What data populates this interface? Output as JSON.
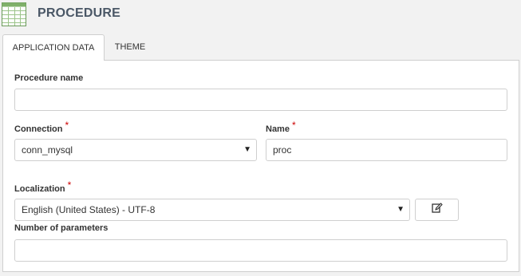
{
  "header": {
    "title": "PROCEDURE",
    "icon": "spreadsheet-icon"
  },
  "tabs": [
    {
      "label": "APPLICATION DATA",
      "active": true
    },
    {
      "label": "THEME",
      "active": false
    }
  ],
  "form": {
    "procedure_name": {
      "label": "Procedure name",
      "value": ""
    },
    "connection": {
      "label": "Connection",
      "required_mark": "*",
      "value": "conn_mysql"
    },
    "name": {
      "label": "Name",
      "required_mark": "*",
      "value": "proc"
    },
    "localization": {
      "label": "Localization",
      "required_mark": "*",
      "value": "English (United States) - UTF-8",
      "edit_icon": "edit-icon"
    },
    "number_of_parameters": {
      "label": "Number of parameters",
      "value": ""
    }
  },
  "colors": {
    "title": "#4a5766",
    "required": "#cc0000",
    "icon_green": "#5cb85c"
  }
}
